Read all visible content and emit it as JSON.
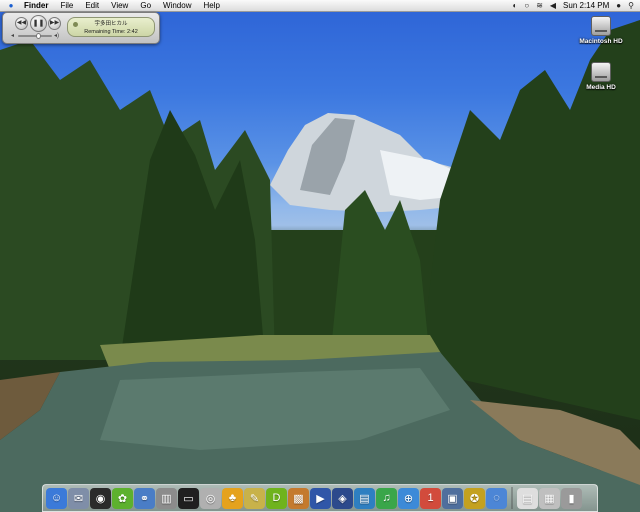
{
  "menubar": {
    "app": "Finder",
    "menus": [
      "File",
      "Edit",
      "View",
      "Go",
      "Window",
      "Help"
    ],
    "clock": "Sun 2:14 PM"
  },
  "mini_player": {
    "track": "宇多田ヒカル",
    "status": "Remaining Time: 2:42",
    "volume_level": 0.6
  },
  "desktop_icons": [
    {
      "label": "Macintosh HD",
      "icon": "hard-drive-icon"
    },
    {
      "label": "Media HD",
      "icon": "hard-drive-icon"
    }
  ],
  "dock": {
    "apps": [
      {
        "icon": "finder-icon",
        "bg": "#3b7ad9"
      },
      {
        "icon": "mail-icon",
        "bg": "#7f8ea8"
      },
      {
        "icon": "dashboard-icon",
        "bg": "#2b2b2b"
      },
      {
        "icon": "flower-app-icon",
        "bg": "#5db12e"
      },
      {
        "icon": "network-icon",
        "bg": "#4a7dc6"
      },
      {
        "icon": "server-icon",
        "bg": "#8c8c8c"
      },
      {
        "icon": "terminal-icon",
        "bg": "#1f1f1f"
      },
      {
        "icon": "disk-utility-icon",
        "bg": "#b0b0b0"
      },
      {
        "icon": "adium-duck-icon",
        "bg": "#e5a21d"
      },
      {
        "icon": "pencil-icon",
        "bg": "#c8b24a"
      },
      {
        "icon": "dreamweaver-icon",
        "bg": "#6fb31d"
      },
      {
        "icon": "photo-icon",
        "bg": "#c47a2e"
      },
      {
        "icon": "imovie-icon",
        "bg": "#3056a8"
      },
      {
        "icon": "idvd-icon",
        "bg": "#2c4a8c"
      },
      {
        "icon": "books-icon",
        "bg": "#2e7fc1"
      },
      {
        "icon": "itunes-icon",
        "bg": "#3aa64a"
      },
      {
        "icon": "safari-icon",
        "bg": "#3c8ad8"
      },
      {
        "icon": "ical-icon",
        "bg": "#d24b3c"
      },
      {
        "icon": "iphoto-icon",
        "bg": "#4f6f9d"
      },
      {
        "icon": "award-icon",
        "bg": "#c4a11f"
      },
      {
        "icon": "ichat-icon",
        "bg": "#4c86d6"
      }
    ],
    "docs": [
      {
        "icon": "document-icon",
        "bg": "#dedede"
      },
      {
        "icon": "preview-icon",
        "bg": "#bfbfbf"
      },
      {
        "icon": "trash-icon",
        "bg": "#9a9a9a"
      }
    ]
  }
}
